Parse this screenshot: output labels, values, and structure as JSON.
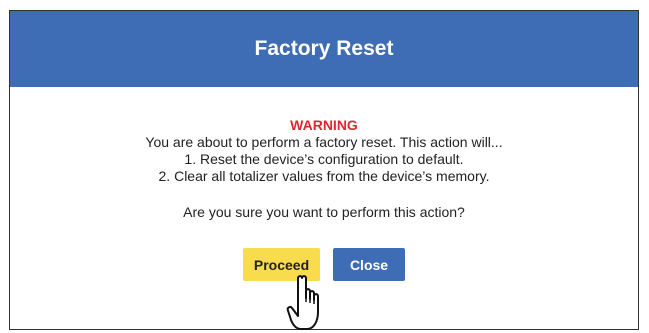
{
  "dialog": {
    "title": "Factory Reset",
    "warning_label": "WARNING",
    "lines": [
      "You are about to perform a factory reset.  This action will...",
      "1. Reset the device’s configuration to default.",
      "2. Clear all totalizer values from the device’s memory."
    ],
    "question": "Are you sure you want to perform this action?",
    "proceed_label": "Proceed",
    "close_label": "Close"
  },
  "colors": {
    "header_bg": "#3e6db5",
    "warning": "#e0272f",
    "proceed_bg": "#f9db4e",
    "close_bg": "#3e6db5"
  },
  "cursor": {
    "icon": "hand-pointer-icon"
  }
}
